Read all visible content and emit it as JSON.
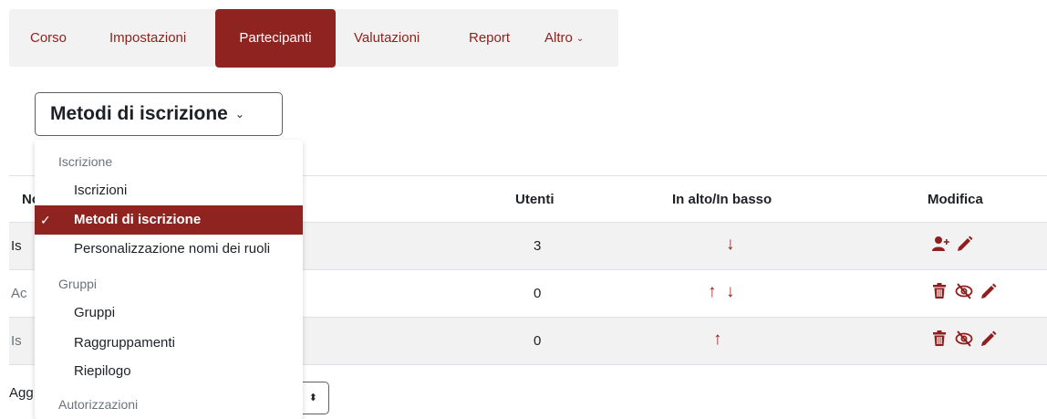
{
  "tabs": [
    {
      "label": "Corso"
    },
    {
      "label": "Impostazioni"
    },
    {
      "label": "Partecipanti"
    },
    {
      "label": "Valutazioni"
    },
    {
      "label": "Report"
    },
    {
      "label": "Altro"
    }
  ],
  "select": {
    "label": "Metodi di iscrizione"
  },
  "table": {
    "headers": {
      "name": "Nome",
      "users": "Utenti",
      "updown": "In alto/In basso",
      "edit": "Modifica"
    },
    "rows": [
      {
        "name": "Is",
        "users": "3"
      },
      {
        "name": "Ac",
        "users": "0"
      },
      {
        "name": "Is",
        "users": "0"
      }
    ]
  },
  "below": {
    "label": "Agg",
    "select_value": "⬍"
  },
  "dropdown": {
    "groups": [
      "Iscrizione",
      "Gruppi",
      "Autorizzazioni"
    ],
    "items": [
      {
        "label": "Iscrizioni"
      },
      {
        "label": "Metodi di iscrizione",
        "check": "✓"
      },
      {
        "label": "Personalizzazione nomi dei ruoli"
      },
      {
        "label": "Gruppi"
      },
      {
        "label": "Raggruppamenti"
      },
      {
        "label": "Riepilogo"
      }
    ]
  },
  "arrows": {
    "down": "↓",
    "up": "↑"
  },
  "colors": {
    "brand": "#8f2320",
    "accent_text": "#8f1f1d",
    "muted": "#6a737b"
  },
  "icons": [
    "add-user-icon",
    "pencil-icon",
    "trash-icon",
    "eye-slash-icon"
  ]
}
